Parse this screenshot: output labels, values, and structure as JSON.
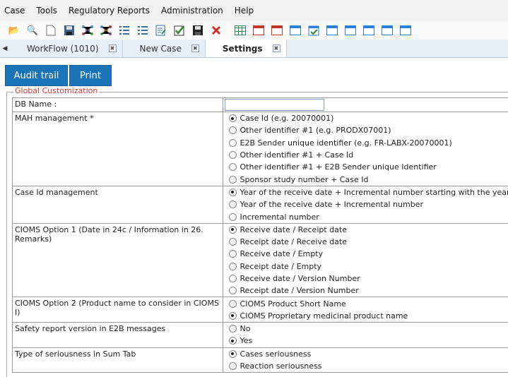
{
  "menu": [
    "Case",
    "Tools",
    "Regulatory Reports",
    "Administration",
    "Help"
  ],
  "toolbar": {
    "icons": [
      "folder-icon",
      "magnifier-icon",
      "new-document-icon",
      "save-icon",
      "molecule-icon",
      "molecule-color-icon",
      "list-icon",
      "list-alt-icon",
      "edit-list-icon",
      "checkbox-icon",
      "save-alt-icon",
      "delete-icon",
      "table-icon",
      "calendar-red-icon",
      "calendar-red-alt-icon",
      "window-icon",
      "calendar-check-icon",
      "window-icon",
      "window-icon",
      "window-icon",
      "window-icon",
      "window-icon"
    ]
  },
  "tabs": [
    {
      "label": "WorkFlow (1010)",
      "active": false
    },
    {
      "label": "New Case",
      "active": false
    },
    {
      "label": "Settings",
      "active": true
    }
  ],
  "buttons": {
    "audit": "Audit trail",
    "print": "Print"
  },
  "section_title": "Global Customization",
  "db_name_label": "DB Name :",
  "db_name_value": "",
  "settings": [
    {
      "label": "MAH management *",
      "options": [
        {
          "text": "Case Id (e.g. 20070001)",
          "selected": true
        },
        {
          "text": "Other identifier #1 (e.g. PRODX07001)",
          "selected": false
        },
        {
          "text": "E2B Sender unique identifier (e.g. FR-LABX-20070001)",
          "selected": false
        },
        {
          "text": "Other identifier #1 + Case Id",
          "selected": false
        },
        {
          "text": "Other identifier #1 + E2B Sender unique Identifier",
          "selected": false
        },
        {
          "text": "Sponsor study number + Case Id",
          "selected": false
        }
      ]
    },
    {
      "label": "Case Id management",
      "options": [
        {
          "text": "Year of the receive date + Incremental number starting with the year.",
          "selected": true
        },
        {
          "text": "Year of the receive date + Incremental number",
          "selected": false
        },
        {
          "text": "Incremental number",
          "selected": false
        }
      ]
    },
    {
      "label": "CIOMS Option 1 (Date in 24c / Information in 26. Remarks)",
      "options": [
        {
          "text": "Receive date / Receipt date",
          "selected": true
        },
        {
          "text": "Receipt date / Receive date",
          "selected": false
        },
        {
          "text": "Receive date / Empty",
          "selected": false
        },
        {
          "text": "Receipt date / Empty",
          "selected": false
        },
        {
          "text": "Receive date / Version Number",
          "selected": false
        },
        {
          "text": "Receipt date / Version Number",
          "selected": false
        }
      ]
    },
    {
      "label": "CIOMS Option 2 (Product name to consider in CIOMS I)",
      "options": [
        {
          "text": "CIOMS Product Short Name",
          "selected": false
        },
        {
          "text": "CIOMS Proprietary medicinal product name",
          "selected": true
        }
      ]
    },
    {
      "label": "Safety report version in E2B messages",
      "options": [
        {
          "text": "No",
          "selected": false
        },
        {
          "text": "Yes",
          "selected": true
        }
      ]
    },
    {
      "label": "Type of seriousness in Sum Tab",
      "options": [
        {
          "text": "Cases seriousness",
          "selected": true
        },
        {
          "text": "Reaction seriousness",
          "selected": false
        }
      ]
    }
  ]
}
